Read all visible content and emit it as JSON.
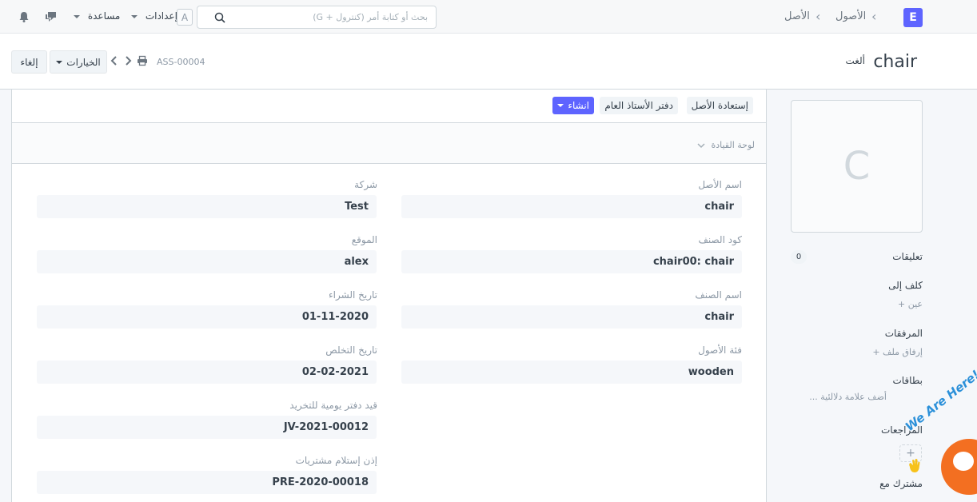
{
  "navbar": {
    "logo": "E",
    "breadcrumb": [
      "الأصول",
      "الأصل"
    ],
    "search_placeholder": "بحث أو كتابة أمر (كنترول + G)",
    "user_initial": "A",
    "settings_label": "إعدادات",
    "help_label": "مساعدة"
  },
  "page_head": {
    "title": "chair",
    "status": "ألغت",
    "docname": "ASS-00004",
    "options_label": "الخيارات",
    "cancel_label": "إلغاء"
  },
  "toolbar": {
    "restore_label": "إستعادة الأصل",
    "ledger_label": "دفتر الأستاذ العام",
    "create_label": "انشاء"
  },
  "dashboard": {
    "label": "لوحة القيادة"
  },
  "fields": {
    "asset_name": {
      "label": "اسم الأصل",
      "value": "chair"
    },
    "item_code": {
      "label": "كود الصنف",
      "value": "chair00: chair"
    },
    "item_name": {
      "label": "اسم الصنف",
      "value": "chair"
    },
    "asset_category": {
      "label": "فئة الأصول",
      "value": "wooden"
    },
    "company": {
      "label": "شركة",
      "value": "Test"
    },
    "location": {
      "label": "الموقع",
      "value": "alex"
    },
    "purchase_date": {
      "label": "تاريخ الشراء",
      "value": "01-11-2020"
    },
    "disposal_date": {
      "label": "تاريخ التخلص",
      "value": "02-02-2021"
    },
    "journal_entry": {
      "label": "قيد دفتر يومية للتخريد",
      "value": "JV-2021-00012"
    },
    "purchase_receipt": {
      "label": "إذن إستلام مشتريات",
      "value": "PRE-2020-00018"
    }
  },
  "sidebar": {
    "image_initial": "C",
    "comments_label": "تعليقات",
    "comments_count": "0",
    "assigned_label": "كلف إلى",
    "assign_link": "عين +",
    "attachments_label": "المرفقات",
    "attach_link": "إرفاق ملف +",
    "tags_label": "بطاقات",
    "tags_link": "أضف علامة دلالئية ...",
    "reviews_label": "المراجعات",
    "shared_label": "مشترك مع"
  },
  "chat_widget": {
    "text": "We Are Here!"
  },
  "colors": {
    "primary": "#5e64ff",
    "chat": "#f36f21"
  }
}
